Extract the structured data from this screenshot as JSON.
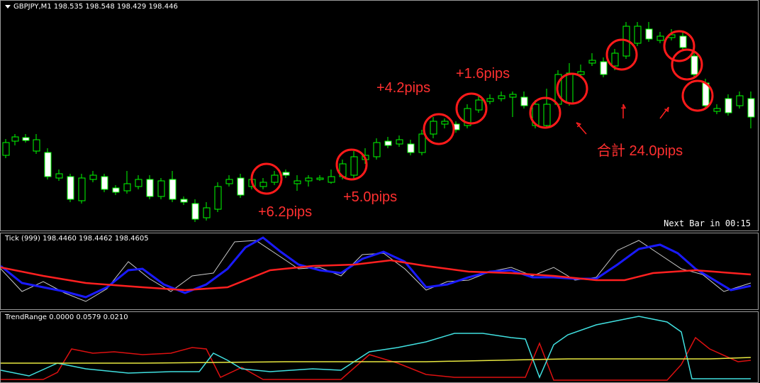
{
  "main": {
    "symbol_header": "GBPJPY,M1  198.535 198.548 198.429 198.446",
    "next_bar": "Next Bar in 00:15",
    "annotations": {
      "p1": "+6.2pips",
      "p2": "+5.0pips",
      "p3": "+4.2pips",
      "p4": "+1.6pips",
      "total": "合計 24.0pips"
    },
    "colors": {
      "bull": "#00ff00",
      "bear": "#ffffff",
      "circle": "#ff1a1a",
      "label_green": "#00ff00",
      "label_red": "#ff2020"
    }
  },
  "tick": {
    "header": "Tick (999) 198.4460 198.4462 198.4605",
    "colors": {
      "raw": "#c8c8c8",
      "fast": "#1a1aff",
      "slow": "#ff2020"
    }
  },
  "trend": {
    "header": "TrendRange 0.0000 0.0579 0.0210",
    "colors": {
      "cyan": "#40e0e0",
      "red": "#dd1010",
      "yellow": "#e8e840"
    }
  }
}
